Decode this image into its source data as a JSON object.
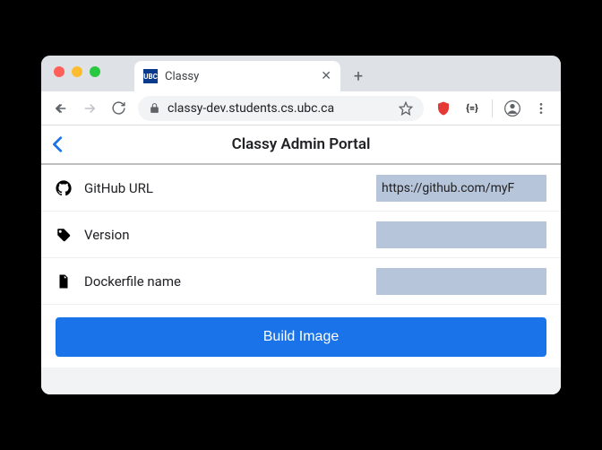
{
  "browser": {
    "tab_title": "Classy",
    "favicon_text": "UBC",
    "url": "classy-dev.students.cs.ubc.ca"
  },
  "app": {
    "title": "Classy Admin Portal"
  },
  "form": {
    "fields": [
      {
        "label": "GitHub URL",
        "value": "https://github.com/myF"
      },
      {
        "label": "Version",
        "value": ""
      },
      {
        "label": "Dockerfile name",
        "value": ""
      }
    ],
    "submit_label": "Build Image"
  }
}
